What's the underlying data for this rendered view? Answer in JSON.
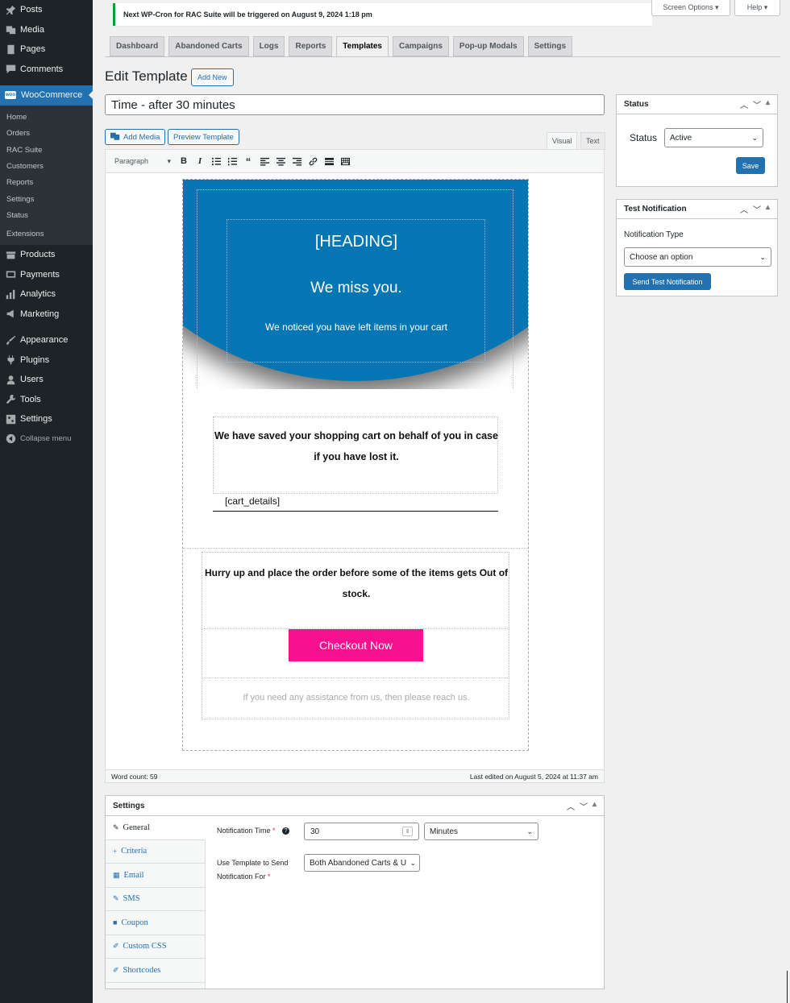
{
  "sidebar": {
    "top_items": [
      {
        "label": "Posts",
        "icon": "pushpin-icon"
      },
      {
        "label": "Media",
        "icon": "media-icon"
      },
      {
        "label": "Pages",
        "icon": "pages-icon"
      },
      {
        "label": "Comments",
        "icon": "comments-icon"
      }
    ],
    "woocommerce": {
      "label": "WooCommerce",
      "badge": "woo"
    },
    "submenu": [
      "Home",
      "Orders",
      "RAC Suite",
      "Customers",
      "Reports",
      "Settings",
      "Status",
      "Extensions"
    ],
    "mid_items": [
      {
        "label": "Products",
        "icon": "products-icon"
      },
      {
        "label": "Payments",
        "icon": "payments-icon"
      },
      {
        "label": "Analytics",
        "icon": "analytics-icon"
      },
      {
        "label": "Marketing",
        "icon": "marketing-icon"
      }
    ],
    "bottom_items": [
      {
        "label": "Appearance",
        "icon": "appearance-icon"
      },
      {
        "label": "Plugins",
        "icon": "plugins-icon"
      },
      {
        "label": "Users",
        "icon": "users-icon"
      },
      {
        "label": "Tools",
        "icon": "tools-icon"
      },
      {
        "label": "Settings",
        "icon": "settings-icon"
      }
    ],
    "collapse": "Collapse menu"
  },
  "notice": {
    "text": "Next WP-Cron for RAC Suite will be triggered on August 9, 2024 1:18 pm"
  },
  "top_buttons": {
    "screen_options": "Screen Options ▾",
    "help": "Help ▾"
  },
  "tabs": [
    "Dashboard",
    "Abandoned Carts",
    "Logs",
    "Reports",
    "Templates",
    "Campaigns",
    "Pop-up Modals",
    "Settings"
  ],
  "active_tab": "Templates",
  "page": {
    "title": "Edit Template",
    "add_new": "Add New"
  },
  "template_title": "Time - after 30 minutes",
  "editor": {
    "add_media": "Add Media",
    "preview": "Preview Template",
    "mode_visual": "Visual",
    "mode_text": "Text",
    "format": "Paragraph",
    "word_count": "Word count: 59",
    "last_edited": "Last edited on August 5, 2024 at 11:37 am"
  },
  "email": {
    "heading": "[HEADING]",
    "miss": "We miss you.",
    "noticed": "We noticed you have left items in your cart",
    "saved": "We have saved your shopping cart on behalf of you in case if you have lost it.",
    "cart_details": "[cart_details]",
    "hurry": "Hurry up and place the order before some of the items gets Out of stock.",
    "checkout": "Checkout Now",
    "assist": "If you need any assistance from us, then please reach us."
  },
  "status_box": {
    "title": "Status",
    "label": "Status",
    "value": "Active",
    "save": "Save"
  },
  "test_box": {
    "title": "Test Notification",
    "type_label": "Notification Type",
    "placeholder": "Choose an option",
    "send": "Send Test Notification"
  },
  "settings": {
    "title": "Settings",
    "tabs": [
      {
        "label": "General",
        "icon": "wrench-icon",
        "glyph": "🔧"
      },
      {
        "label": "Criteria",
        "icon": "plus-icon",
        "glyph": "+"
      },
      {
        "label": "Email",
        "icon": "email-icon",
        "glyph": "▦"
      },
      {
        "label": "SMS",
        "icon": "sms-icon",
        "glyph": "✎"
      },
      {
        "label": "Coupon",
        "icon": "coupon-icon",
        "glyph": "■"
      },
      {
        "label": "Custom CSS",
        "icon": "css-icon",
        "glyph": "✐"
      },
      {
        "label": "Shortcodes",
        "icon": "shortcodes-icon",
        "glyph": "✐"
      }
    ],
    "notification_time_label": "Notification Time",
    "notification_time_value": "30",
    "unit": "Minutes",
    "use_template_label": "Use Template to Send Notification For",
    "use_template_value": "Both Abandoned Carts & U"
  },
  "colors": {
    "accent": "#2271b1",
    "sidebar": "#1d2327",
    "email_blue": "#0576b4",
    "checkout_pink": "#f8118e",
    "notice_green": "#00a32a"
  }
}
